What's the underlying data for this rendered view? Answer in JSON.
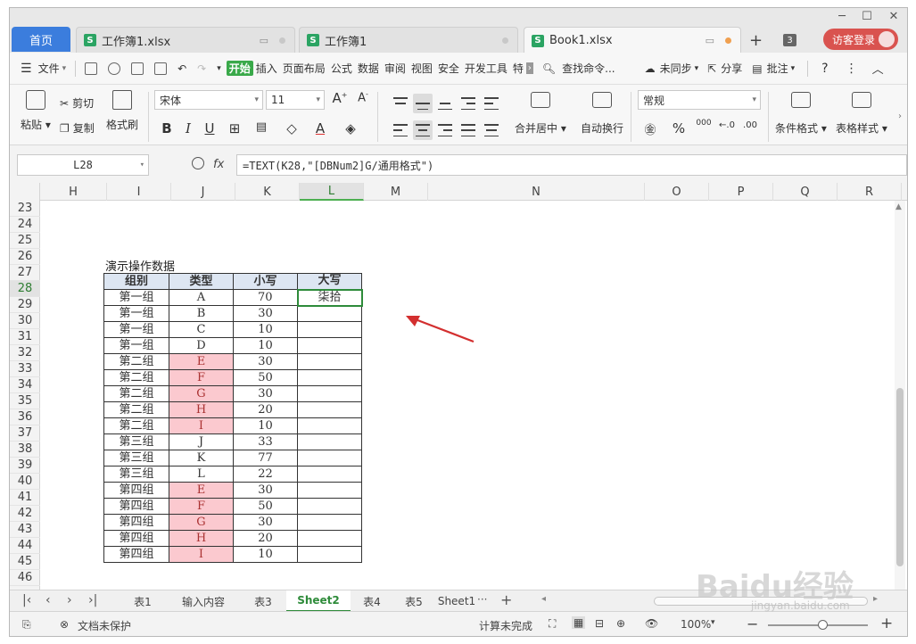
{
  "window": {
    "min_icon": "minimize-icon",
    "max_icon": "maximize-icon",
    "close_icon": "close-icon"
  },
  "tabs": {
    "home": "首页",
    "docs": [
      {
        "label": "工作簿1.xlsx",
        "icon": "S"
      },
      {
        "label": "工作簿1",
        "icon": "S"
      },
      {
        "label": "Book1.xlsx",
        "icon": "S"
      }
    ],
    "new_tab": "+",
    "count": "3",
    "login": "访客登录"
  },
  "menu": {
    "file": "文件",
    "items": [
      "开始",
      "插入",
      "页面布局",
      "公式",
      "数据",
      "审阅",
      "视图",
      "安全",
      "开发工具",
      "特"
    ],
    "search": "查找命令...",
    "sync": "未同步",
    "share": "分享",
    "annotate": "批注",
    "help": "?"
  },
  "ribbon": {
    "paste": "粘贴",
    "cut": "剪切",
    "copy": "复制",
    "format_painter": "格式刷",
    "font_name": "宋体",
    "font_size": "11",
    "bold": "B",
    "italic": "I",
    "underline": "U",
    "merge_center": "合并居中",
    "wrap_text": "自动换行",
    "number_format": "常规",
    "percent": "%",
    "thousands": "000",
    "cond_format": "条件格式",
    "table_style": "表格样式"
  },
  "formula_bar": {
    "cell_ref": "L28",
    "fx": "fx",
    "formula": "=TEXT(K28,\"[DBNum2]G/通用格式\")"
  },
  "grid": {
    "columns": [
      "H",
      "I",
      "J",
      "K",
      "L",
      "M",
      "N",
      "O",
      "P",
      "Q",
      "R"
    ],
    "selected_column": "L",
    "rows": [
      "23",
      "24",
      "25",
      "26",
      "27",
      "28",
      "29",
      "30",
      "31",
      "32",
      "33",
      "34",
      "35",
      "36",
      "37",
      "38",
      "39",
      "40",
      "41",
      "42",
      "43",
      "44",
      "45",
      "46"
    ],
    "selected_row": "28",
    "caption": "演示操作数据",
    "headers": [
      "组别",
      "类型",
      "小写",
      "大写"
    ],
    "data": [
      [
        "第一组",
        "A",
        "70",
        "柒拾"
      ],
      [
        "第一组",
        "B",
        "30",
        ""
      ],
      [
        "第一组",
        "C",
        "10",
        ""
      ],
      [
        "第一组",
        "D",
        "10",
        ""
      ],
      [
        "第二组",
        "E",
        "30",
        ""
      ],
      [
        "第二组",
        "F",
        "50",
        ""
      ],
      [
        "第二组",
        "G",
        "30",
        ""
      ],
      [
        "第二组",
        "H",
        "20",
        ""
      ],
      [
        "第二组",
        "I",
        "10",
        ""
      ],
      [
        "第三组",
        "J",
        "33",
        ""
      ],
      [
        "第三组",
        "K",
        "77",
        ""
      ],
      [
        "第三组",
        "L",
        "22",
        ""
      ],
      [
        "第四组",
        "E",
        "30",
        ""
      ],
      [
        "第四组",
        "F",
        "50",
        ""
      ],
      [
        "第四组",
        "G",
        "30",
        ""
      ],
      [
        "第四组",
        "H",
        "20",
        ""
      ],
      [
        "第四组",
        "I",
        "10",
        ""
      ]
    ],
    "pink_type_rows": [
      4,
      5,
      6,
      7,
      8,
      12,
      13,
      14,
      15,
      16
    ]
  },
  "sheets": {
    "tabs": [
      "表1",
      "输入内容",
      "表3",
      "Sheet2",
      "表4",
      "表5",
      "Sheet1"
    ],
    "active": "Sheet2"
  },
  "status": {
    "protect": "文档未保护",
    "calc": "计算未完成",
    "zoom": "100%"
  },
  "watermark": {
    "text": "Baidu经验",
    "url": "jingyan.baidu.com"
  },
  "colors": {
    "accent": "#2e8b3a",
    "home_tab": "#3b7ddd",
    "pink_cell": "#fbc9cf",
    "header_fill": "#dde6f2",
    "arrow": "#d32f2f"
  }
}
